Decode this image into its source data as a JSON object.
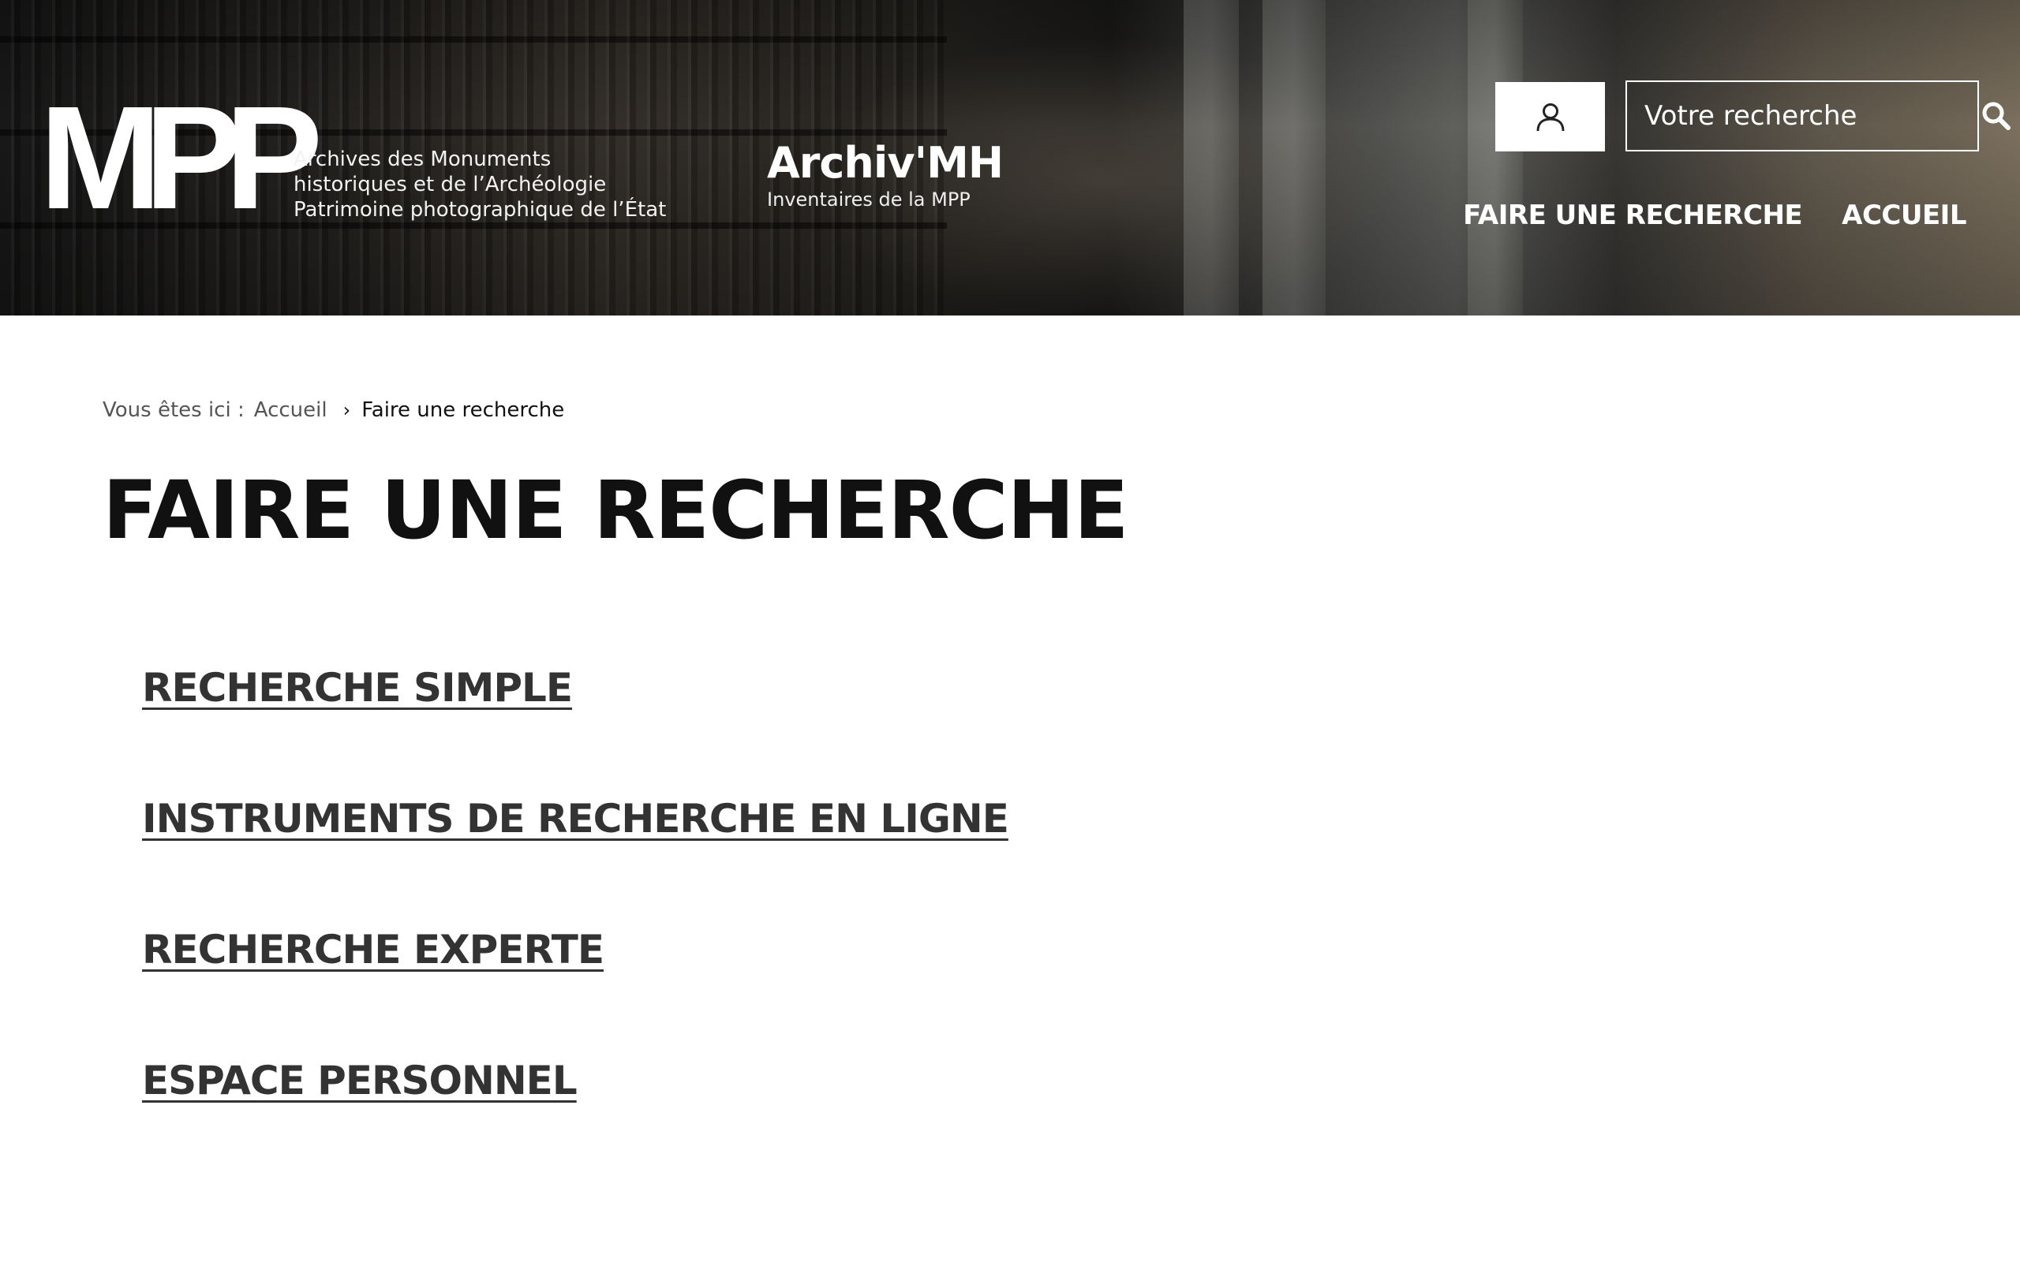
{
  "header": {
    "logo_mark": "MPP",
    "logo_lines": [
      "Archives des Monuments",
      "historiques et de l’Archéologie",
      "Patrimoine photographique de l’État"
    ],
    "site_name": "Archiv'MH",
    "site_subtitle": "Inventaires de la MPP",
    "user_icon": "user-icon",
    "search": {
      "placeholder": "Votre recherche",
      "icon": "search-icon"
    },
    "nav": [
      {
        "label": "FAIRE UNE RECHERCHE"
      },
      {
        "label": "ACCUEIL"
      }
    ]
  },
  "breadcrumb": {
    "prefix": "Vous êtes ici :",
    "items": [
      {
        "label": "Accueil"
      },
      {
        "label": "Faire une recherche"
      }
    ]
  },
  "page": {
    "title": "FAIRE UNE RECHERCHE",
    "links": [
      {
        "label": "RECHERCHE SIMPLE"
      },
      {
        "label": "INSTRUMENTS DE RECHERCHE EN LIGNE"
      },
      {
        "label": "RECHERCHE EXPERTE"
      },
      {
        "label": "ESPACE PERSONNEL"
      }
    ]
  }
}
